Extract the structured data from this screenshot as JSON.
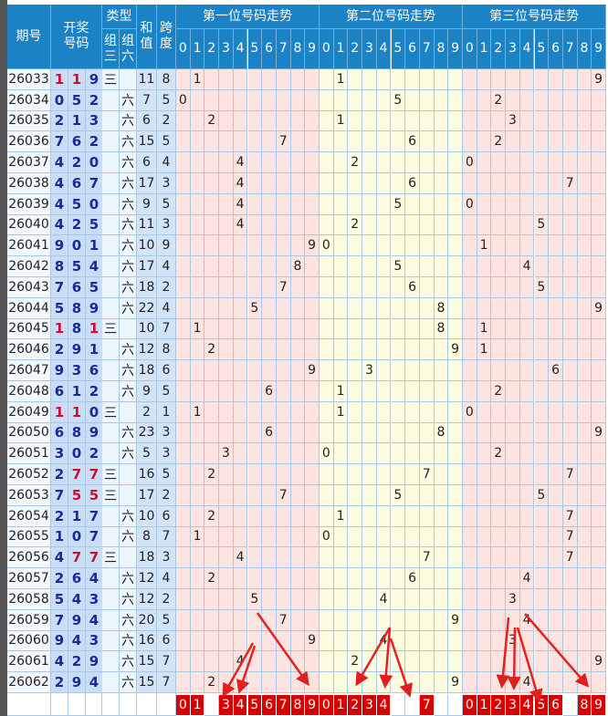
{
  "header": {
    "period": "期号",
    "numbers": "开奖\n号码",
    "type": "类型",
    "zu3": "组\n三",
    "zu6": "组\n六",
    "sum": "和\n值",
    "span": "跨\n度",
    "groups": [
      "第一位号码走势",
      "第二位号码走势",
      "第三位号码走势"
    ],
    "digits": [
      "0",
      "1",
      "2",
      "3",
      "4",
      "5",
      "6",
      "7",
      "8",
      "9"
    ]
  },
  "colors": {
    "header": "#1b82c5",
    "pos_pink": "#fde4e0",
    "pos_yellow": "#fdfde1",
    "hit": "#d80000",
    "repeat_digit": "#c8102e"
  },
  "type_labels": {
    "zu3": "三",
    "zu6": "六"
  },
  "rows": [
    [
      "26033",
      "119",
      "三",
      "11",
      "8"
    ],
    [
      "26034",
      "052",
      "六",
      "7",
      "5"
    ],
    [
      "26035",
      "213",
      "六",
      "6",
      "2"
    ],
    [
      "26036",
      "762",
      "六",
      "15",
      "5"
    ],
    [
      "26037",
      "420",
      "六",
      "6",
      "4"
    ],
    [
      "26038",
      "467",
      "六",
      "17",
      "3"
    ],
    [
      "26039",
      "450",
      "六",
      "9",
      "5"
    ],
    [
      "26040",
      "425",
      "六",
      "11",
      "3"
    ],
    [
      "26041",
      "901",
      "六",
      "10",
      "9"
    ],
    [
      "26042",
      "854",
      "六",
      "17",
      "4"
    ],
    [
      "26043",
      "765",
      "六",
      "18",
      "2"
    ],
    [
      "26044",
      "589",
      "六",
      "22",
      "4"
    ],
    [
      "26045",
      "181",
      "三",
      "10",
      "7"
    ],
    [
      "26046",
      "291",
      "六",
      "12",
      "8"
    ],
    [
      "26047",
      "936",
      "六",
      "18",
      "6"
    ],
    [
      "26048",
      "612",
      "六",
      "9",
      "5"
    ],
    [
      "26049",
      "110",
      "三",
      "2",
      "1"
    ],
    [
      "26050",
      "689",
      "六",
      "23",
      "3"
    ],
    [
      "26051",
      "302",
      "六",
      "5",
      "3"
    ],
    [
      "26052",
      "277",
      "三",
      "16",
      "5"
    ],
    [
      "26053",
      "755",
      "三",
      "17",
      "2"
    ],
    [
      "26054",
      "217",
      "六",
      "10",
      "6"
    ],
    [
      "26055",
      "107",
      "六",
      "8",
      "7"
    ],
    [
      "26056",
      "477",
      "三",
      "18",
      "3"
    ],
    [
      "26057",
      "264",
      "六",
      "12",
      "4"
    ],
    [
      "26058",
      "543",
      "六",
      "12",
      "2"
    ],
    [
      "26059",
      "794",
      "六",
      "20",
      "5"
    ],
    [
      "26060",
      "943",
      "六",
      "16",
      "6"
    ],
    [
      "26061",
      "429",
      "六",
      "15",
      "7"
    ],
    [
      "26062",
      "294",
      "六",
      "15",
      "7"
    ]
  ],
  "bottom_selection": [
    [
      "0",
      "1",
      "",
      "3",
      "4",
      "5",
      "6",
      "7",
      "8",
      "9"
    ],
    [
      "0",
      "1",
      "2",
      "3",
      "4",
      "",
      "",
      "7",
      "",
      ""
    ],
    [
      "0",
      "1",
      "2",
      "3",
      "4",
      "5",
      "6",
      "",
      "8",
      "9"
    ]
  ]
}
